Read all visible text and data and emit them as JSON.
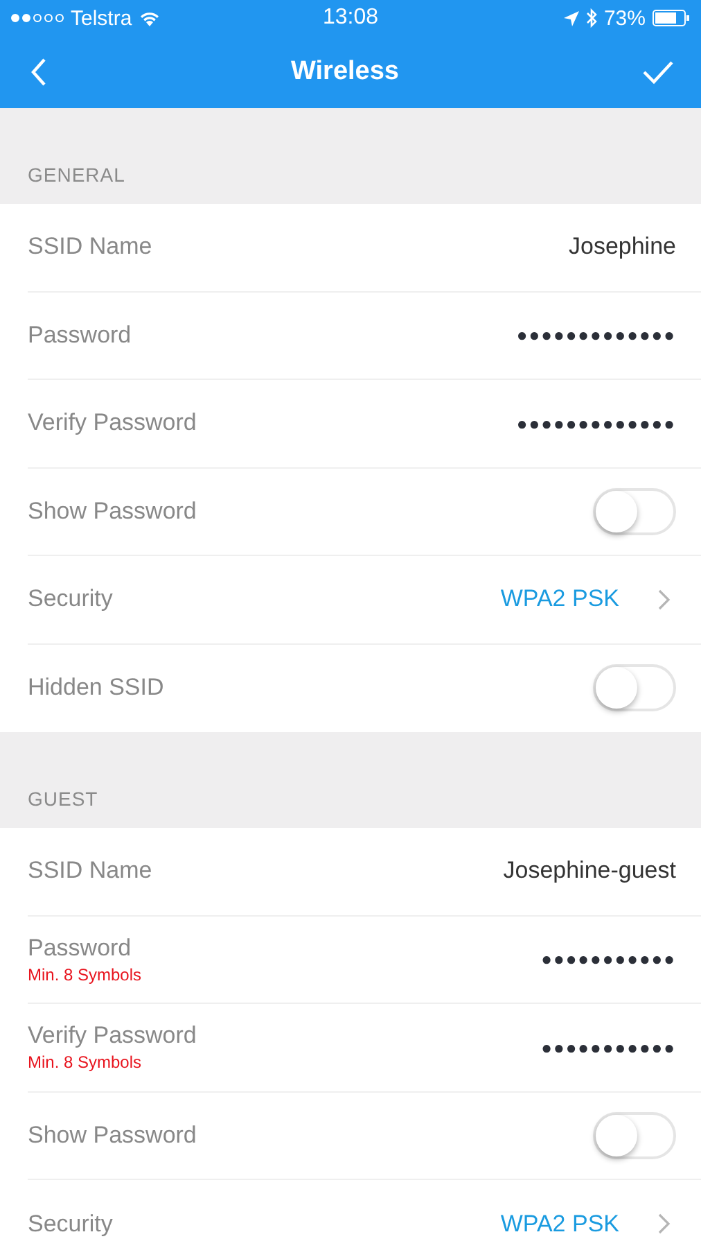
{
  "status_bar": {
    "carrier": "Telstra",
    "time": "13:08",
    "battery": "73%"
  },
  "nav": {
    "title": "Wireless"
  },
  "sections": [
    {
      "title": "GENERAL",
      "rows": [
        {
          "kind": "text",
          "label": "SSID Name",
          "value": "Josephine"
        },
        {
          "kind": "password",
          "label": "Password",
          "value": "●●●●●●●●●●●●●"
        },
        {
          "kind": "password",
          "label": "Verify Password",
          "value": "●●●●●●●●●●●●●"
        },
        {
          "kind": "toggle",
          "label": "Show Password",
          "on": false
        },
        {
          "kind": "select",
          "label": "Security",
          "value": "WPA2 PSK"
        },
        {
          "kind": "toggle",
          "label": "Hidden SSID",
          "on": false
        }
      ]
    },
    {
      "title": "GUEST",
      "rows": [
        {
          "kind": "text",
          "label": "SSID Name",
          "value": "Josephine-guest"
        },
        {
          "kind": "password",
          "label": "Password",
          "hint": "Min. 8 Symbols",
          "value": "●●●●●●●●●●●"
        },
        {
          "kind": "password",
          "label": "Verify Password",
          "hint": "Min. 8 Symbols",
          "value": "●●●●●●●●●●●"
        },
        {
          "kind": "toggle",
          "label": "Show Password",
          "on": false
        },
        {
          "kind": "select",
          "label": "Security",
          "value": "WPA2 PSK"
        }
      ]
    }
  ]
}
